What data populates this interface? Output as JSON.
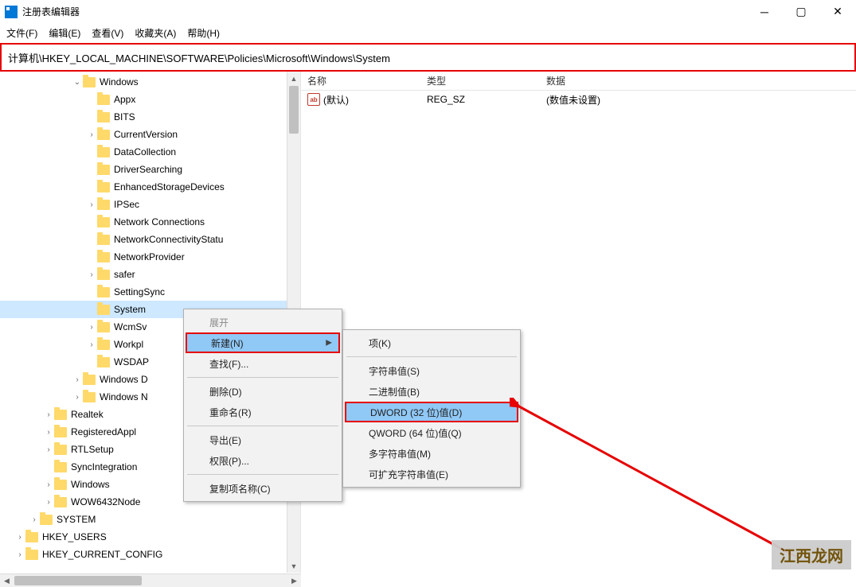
{
  "title": "注册表编辑器",
  "menubar": [
    "文件(F)",
    "编辑(E)",
    "查看(V)",
    "收藏夹(A)",
    "帮助(H)"
  ],
  "address": "计算机\\HKEY_LOCAL_MACHINE\\SOFTWARE\\Policies\\Microsoft\\Windows\\System",
  "tree": [
    {
      "depth": 5,
      "exp": "v",
      "label": "Windows"
    },
    {
      "depth": 6,
      "exp": "",
      "label": "Appx"
    },
    {
      "depth": 6,
      "exp": "",
      "label": "BITS"
    },
    {
      "depth": 6,
      "exp": ">",
      "label": "CurrentVersion"
    },
    {
      "depth": 6,
      "exp": "",
      "label": "DataCollection"
    },
    {
      "depth": 6,
      "exp": "",
      "label": "DriverSearching"
    },
    {
      "depth": 6,
      "exp": "",
      "label": "EnhancedStorageDevices"
    },
    {
      "depth": 6,
      "exp": ">",
      "label": "IPSec"
    },
    {
      "depth": 6,
      "exp": "",
      "label": "Network Connections"
    },
    {
      "depth": 6,
      "exp": "",
      "label": "NetworkConnectivityStatu"
    },
    {
      "depth": 6,
      "exp": "",
      "label": "NetworkProvider"
    },
    {
      "depth": 6,
      "exp": ">",
      "label": "safer"
    },
    {
      "depth": 6,
      "exp": "",
      "label": "SettingSync"
    },
    {
      "depth": 6,
      "exp": "",
      "label": "System",
      "selected": true
    },
    {
      "depth": 6,
      "exp": ">",
      "label": "WcmSv"
    },
    {
      "depth": 6,
      "exp": ">",
      "label": "Workpl"
    },
    {
      "depth": 6,
      "exp": "",
      "label": "WSDAP"
    },
    {
      "depth": 5,
      "exp": ">",
      "label": "Windows D"
    },
    {
      "depth": 5,
      "exp": ">",
      "label": "Windows N"
    },
    {
      "depth": 3,
      "exp": ">",
      "label": "Realtek"
    },
    {
      "depth": 3,
      "exp": ">",
      "label": "RegisteredAppl"
    },
    {
      "depth": 3,
      "exp": ">",
      "label": "RTLSetup"
    },
    {
      "depth": 3,
      "exp": "",
      "label": "SyncIntegration"
    },
    {
      "depth": 3,
      "exp": ">",
      "label": "Windows"
    },
    {
      "depth": 3,
      "exp": ">",
      "label": "WOW6432Node"
    },
    {
      "depth": 2,
      "exp": ">",
      "label": "SYSTEM"
    },
    {
      "depth": 1,
      "exp": ">",
      "label": "HKEY_USERS"
    },
    {
      "depth": 1,
      "exp": ">",
      "label": "HKEY_CURRENT_CONFIG"
    }
  ],
  "list": {
    "columns": {
      "name": "名称",
      "type": "类型",
      "data": "数据"
    },
    "rows": [
      {
        "icon": "ab",
        "name": "(默认)",
        "type": "REG_SZ",
        "data": "(数值未设置)"
      }
    ]
  },
  "ctx1": {
    "items": [
      {
        "label": "展开",
        "disabled": true
      },
      {
        "label": "新建(N)",
        "highlight": true,
        "submenu": true,
        "red": true
      },
      {
        "label": "查找(F)..."
      },
      {
        "sep": true
      },
      {
        "label": "删除(D)"
      },
      {
        "label": "重命名(R)"
      },
      {
        "sep": true
      },
      {
        "label": "导出(E)"
      },
      {
        "label": "权限(P)..."
      },
      {
        "sep": true
      },
      {
        "label": "复制项名称(C)"
      }
    ]
  },
  "ctx2": {
    "items": [
      {
        "label": "项(K)"
      },
      {
        "sep": true
      },
      {
        "label": "字符串值(S)"
      },
      {
        "label": "二进制值(B)"
      },
      {
        "label": "DWORD (32 位)值(D)",
        "highlight": true,
        "red": true
      },
      {
        "label": "QWORD (64 位)值(Q)"
      },
      {
        "label": "多字符串值(M)"
      },
      {
        "label": "可扩充字符串值(E)"
      }
    ]
  },
  "watermark": "江西龙网"
}
